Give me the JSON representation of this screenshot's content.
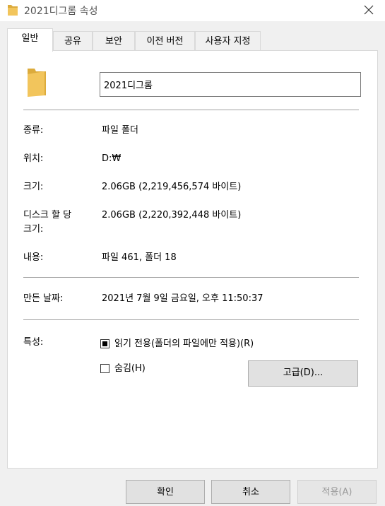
{
  "window": {
    "title": "2021디그롬 속성"
  },
  "tabs": [
    {
      "label": "일반"
    },
    {
      "label": "공유"
    },
    {
      "label": "보안"
    },
    {
      "label": "이전 버전"
    },
    {
      "label": "사용자 지정"
    }
  ],
  "general": {
    "folder_name": "2021디그롬",
    "type_label": "종류:",
    "type_value": "파일 폴더",
    "location_label": "위치:",
    "location_value": "D:₩",
    "size_label": "크기:",
    "size_value": "2.06GB (2,219,456,574 바이트)",
    "size_on_disk_label": "디스크 할 당 크기:",
    "size_on_disk_value": "2.06GB (2,220,392,448 바이트)",
    "contains_label": "내용:",
    "contains_value": "파일 461, 폴더 18",
    "created_label": "만든 날짜:",
    "created_value": "2021년 7월 9일 금요일, 오후 11:50:37",
    "attributes_label": "특성:",
    "readonly_label": "읽기 전용(폴더의 파일에만 적용)(R)",
    "readonly_state": "indeterminate",
    "hidden_label": "숨김(H)",
    "hidden_state": "unchecked",
    "advanced_label": "고급(D)..."
  },
  "footer": {
    "ok_label": "확인",
    "cancel_label": "취소",
    "apply_label": "적용(A)"
  },
  "colors": {
    "folder": "#f2c55c",
    "folder_dark": "#dcab3c",
    "panel_border": "#d9d9d9",
    "button_bg": "#e1e1e1"
  }
}
